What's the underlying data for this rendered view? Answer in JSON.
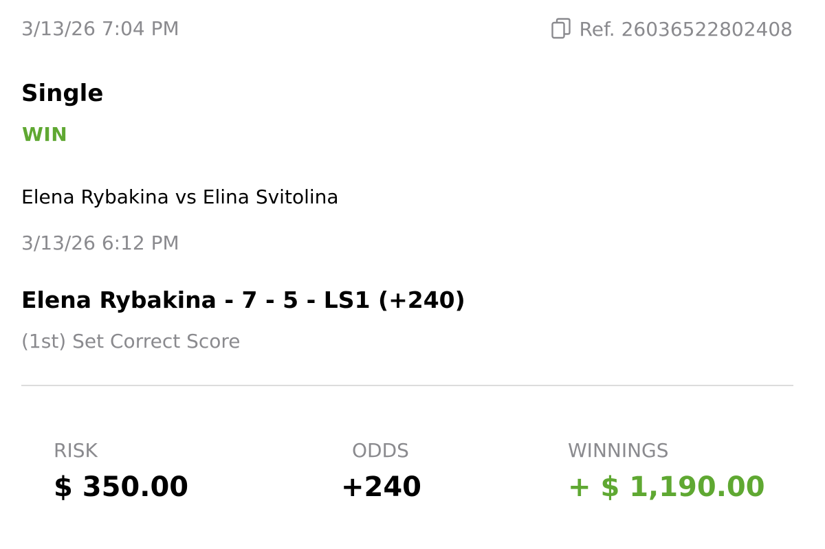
{
  "header": {
    "placed_datetime": "3/13/26 7:04 PM",
    "reference": "Ref. 26036522802408",
    "copy_icon": "copy-icon"
  },
  "bet": {
    "type": "Single",
    "result": "WIN",
    "matchup": "Elena Rybakina vs Elina Svitolina",
    "event_datetime": "3/13/26 6:12 PM",
    "selection": "Elena Rybakina - 7 - 5 - LS1 (+240)",
    "market": "(1st) Set Correct Score"
  },
  "summary": {
    "risk_label": "RISK",
    "risk_value": "$ 350.00",
    "odds_label": "ODDS",
    "odds_value": "+240",
    "winnings_label": "WINNINGS",
    "winnings_value": "+ $ 1,190.00"
  },
  "colors": {
    "win": "#5fa832",
    "muted": "#8a8a8e",
    "text": "#000000",
    "divider": "#dcdcdc"
  }
}
